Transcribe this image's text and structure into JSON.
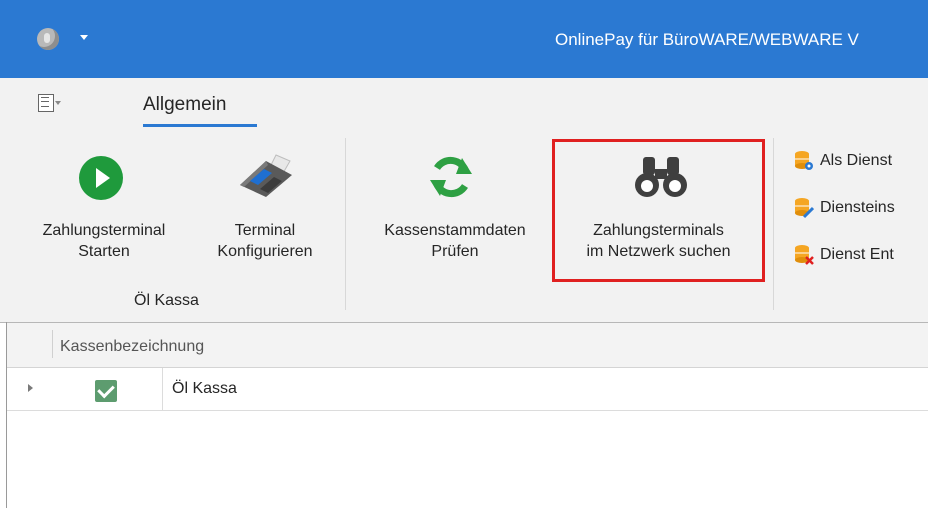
{
  "window": {
    "title": "OnlinePay für BüroWARE/WEBWARE V"
  },
  "ribbon": {
    "active_tab": "Allgemein",
    "groups": [
      {
        "label": "Öl Kassa"
      }
    ],
    "buttons": {
      "start_terminal": {
        "line1": "Zahlungsterminal",
        "line2": "Starten",
        "icon": "play-icon"
      },
      "configure_terminal": {
        "line1": "Terminal",
        "line2": "Konfigurieren",
        "icon": "card-terminal-icon"
      },
      "check_master_data": {
        "line1": "Kassenstammdaten",
        "line2": "Prüfen",
        "icon": "refresh-icon"
      },
      "search_terminals": {
        "line1": "Zahlungsterminals",
        "line2": "im Netzwerk suchen",
        "icon": "binoculars-icon"
      }
    },
    "service_buttons": [
      {
        "label": "Als Dienst",
        "icon": "database-gear-icon"
      },
      {
        "label": "Diensteins",
        "icon": "database-edit-icon"
      },
      {
        "label": "Dienst Ent",
        "icon": "database-remove-icon"
      }
    ]
  },
  "grid": {
    "columns": [
      "Kassenbezeichnung"
    ],
    "rows": [
      {
        "checked": true,
        "name": "Öl Kassa"
      }
    ]
  },
  "colors": {
    "titlebar": "#2b79d2",
    "highlight": "#e02020",
    "play": "#1f9a3c",
    "check": "#5d9c6f"
  }
}
